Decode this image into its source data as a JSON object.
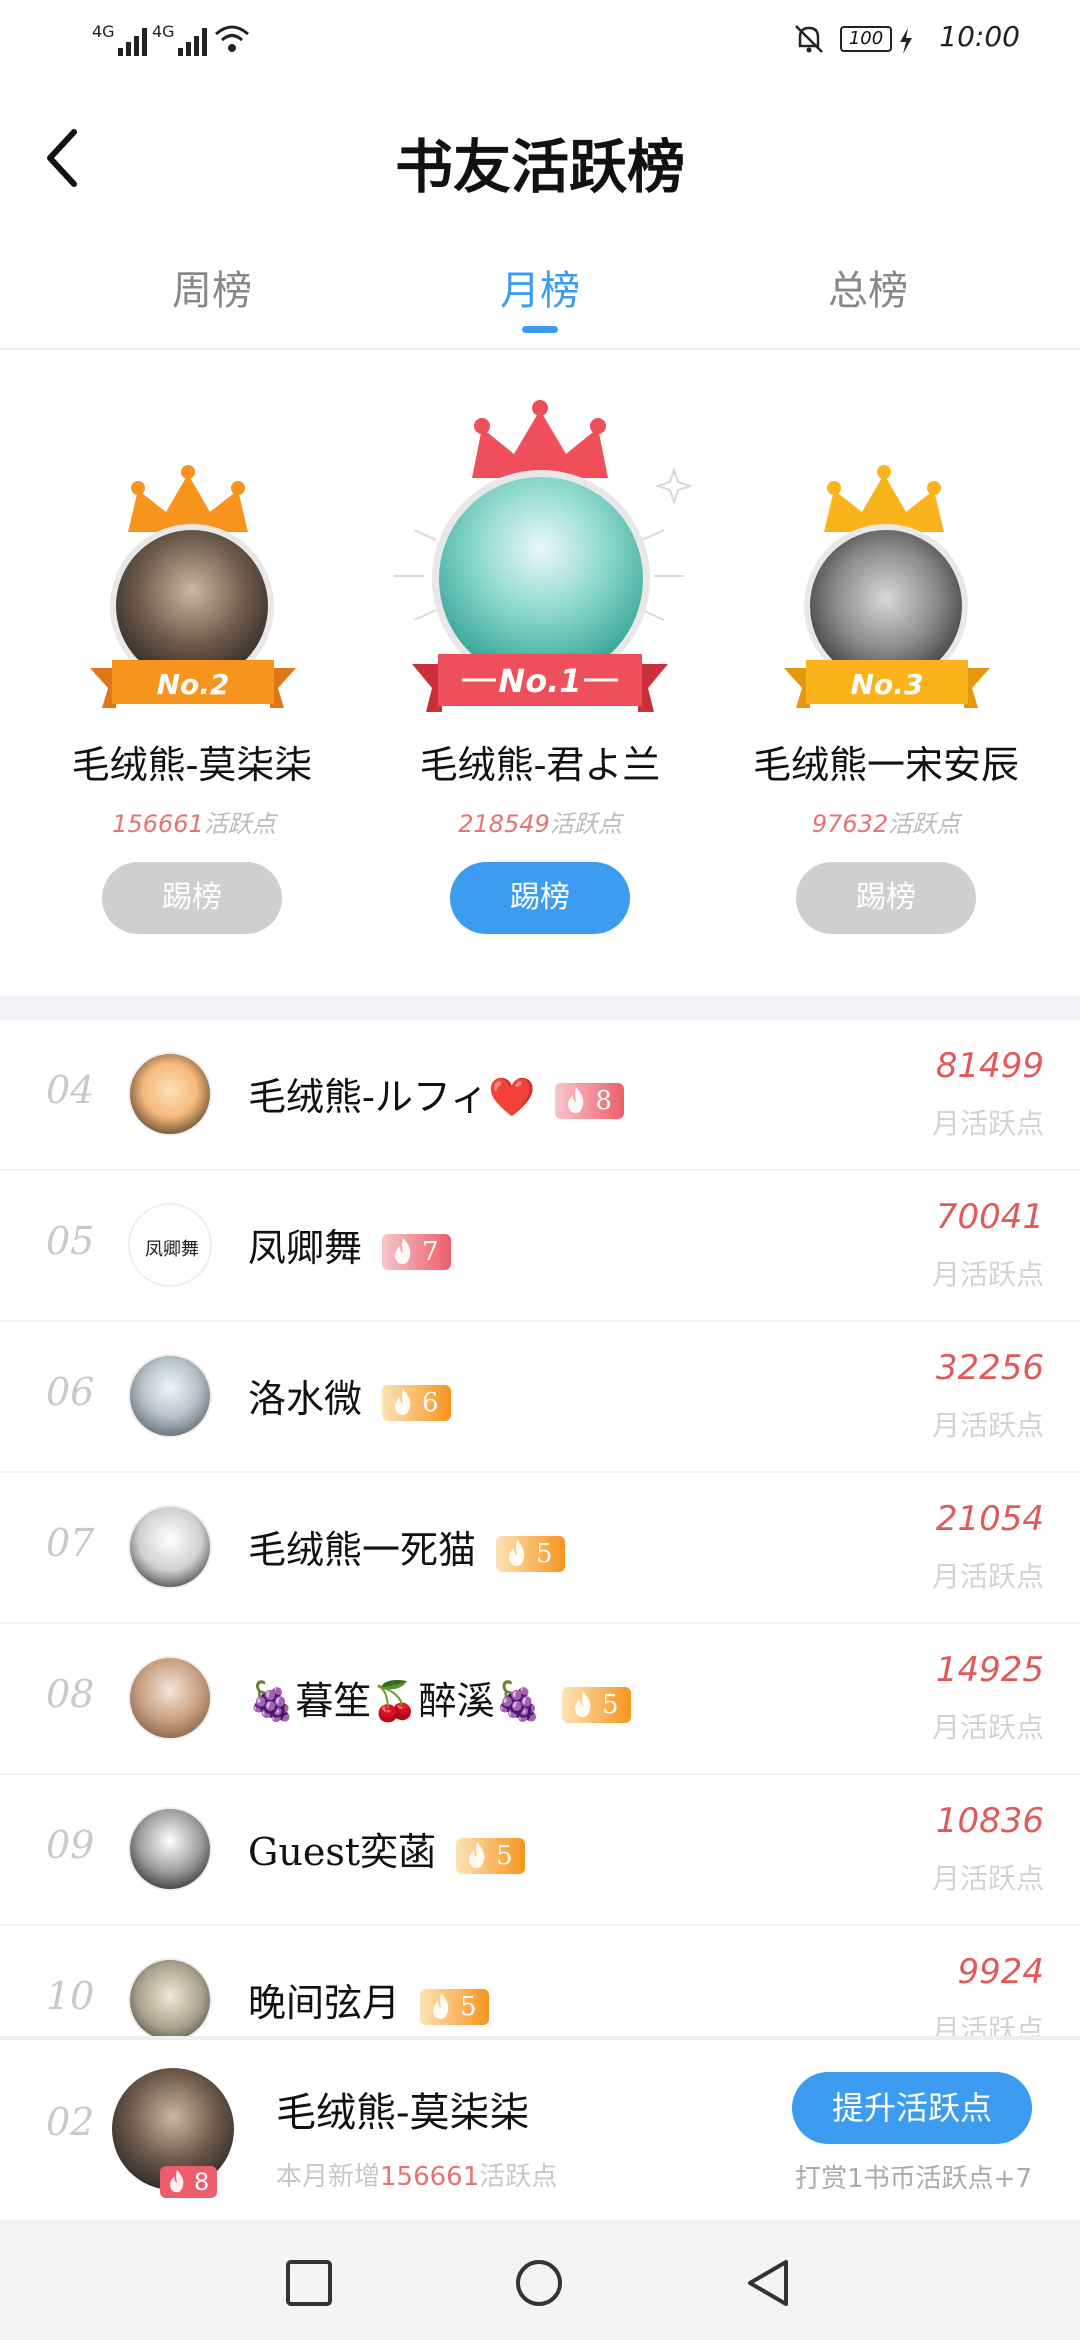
{
  "status_bar": {
    "signal1": "4G",
    "signal2": "4G",
    "battery": "100",
    "time": "10:00",
    "icons": [
      "signal-icon",
      "wifi-icon",
      "mute-bell-icon",
      "battery-icon",
      "charging-icon"
    ]
  },
  "header": {
    "title": "书友活跃榜",
    "back_icon": "back-arrow-icon"
  },
  "tabs": [
    {
      "label": "周榜",
      "active": false
    },
    {
      "label": "月榜",
      "active": true
    },
    {
      "label": "总榜",
      "active": false
    }
  ],
  "podium": [
    {
      "position": "No.2",
      "name": "毛绒熊-莫柒柒",
      "points": "156661",
      "points_suffix": "活跃点",
      "button": "踢榜",
      "crown_color": "#f7941d"
    },
    {
      "position": "No.1",
      "name": "毛绒熊-君よ兰",
      "points": "218549",
      "points_suffix": "活跃点",
      "button": "踢榜",
      "crown_color": "#ef4f5a"
    },
    {
      "position": "No.3",
      "name": "毛绒熊一宋安辰",
      "points": "97632",
      "points_suffix": "活跃点",
      "button": "踢榜",
      "crown_color": "#fbb31b"
    }
  ],
  "list": [
    {
      "rank": "04",
      "name": "毛绒熊-ルフィ❤️",
      "level": "8",
      "badge": "red",
      "points": "81499",
      "label": "月活跃点"
    },
    {
      "rank": "05",
      "name": "凤卿舞",
      "level": "7",
      "badge": "red",
      "points": "70041",
      "label": "月活跃点"
    },
    {
      "rank": "06",
      "name": "洛水微",
      "level": "6",
      "badge": "orange",
      "points": "32256",
      "label": "月活跃点"
    },
    {
      "rank": "07",
      "name": "毛绒熊一死猫",
      "level": "5",
      "badge": "orange",
      "points": "21054",
      "label": "月活跃点"
    },
    {
      "rank": "08",
      "name": "🍇暮笙🍒醉溪🍇",
      "level": "5",
      "badge": "orange",
      "points": "14925",
      "label": "月活跃点"
    },
    {
      "rank": "09",
      "name": "Guest奕菡",
      "level": "5",
      "badge": "orange",
      "points": "10836",
      "label": "月活跃点"
    },
    {
      "rank": "10",
      "name": "晚间弦月",
      "level": "5",
      "badge": "orange",
      "points": "9924",
      "label": "月活跃点"
    }
  ],
  "my_rank": {
    "rank": "02",
    "name": "毛绒熊-莫柒柒",
    "level": "8",
    "sub_prefix": "本月新增",
    "sub_points": "156661",
    "sub_suffix": "活跃点",
    "button": "提升活跃点",
    "tip": "打赏1书币活跃点+7"
  },
  "colors": {
    "accent": "#3c9cf2",
    "points_red": "#e05a5a",
    "muted": "#c9c9c9"
  },
  "nav_icons": [
    "recent-apps-icon",
    "home-icon",
    "back-icon"
  ]
}
